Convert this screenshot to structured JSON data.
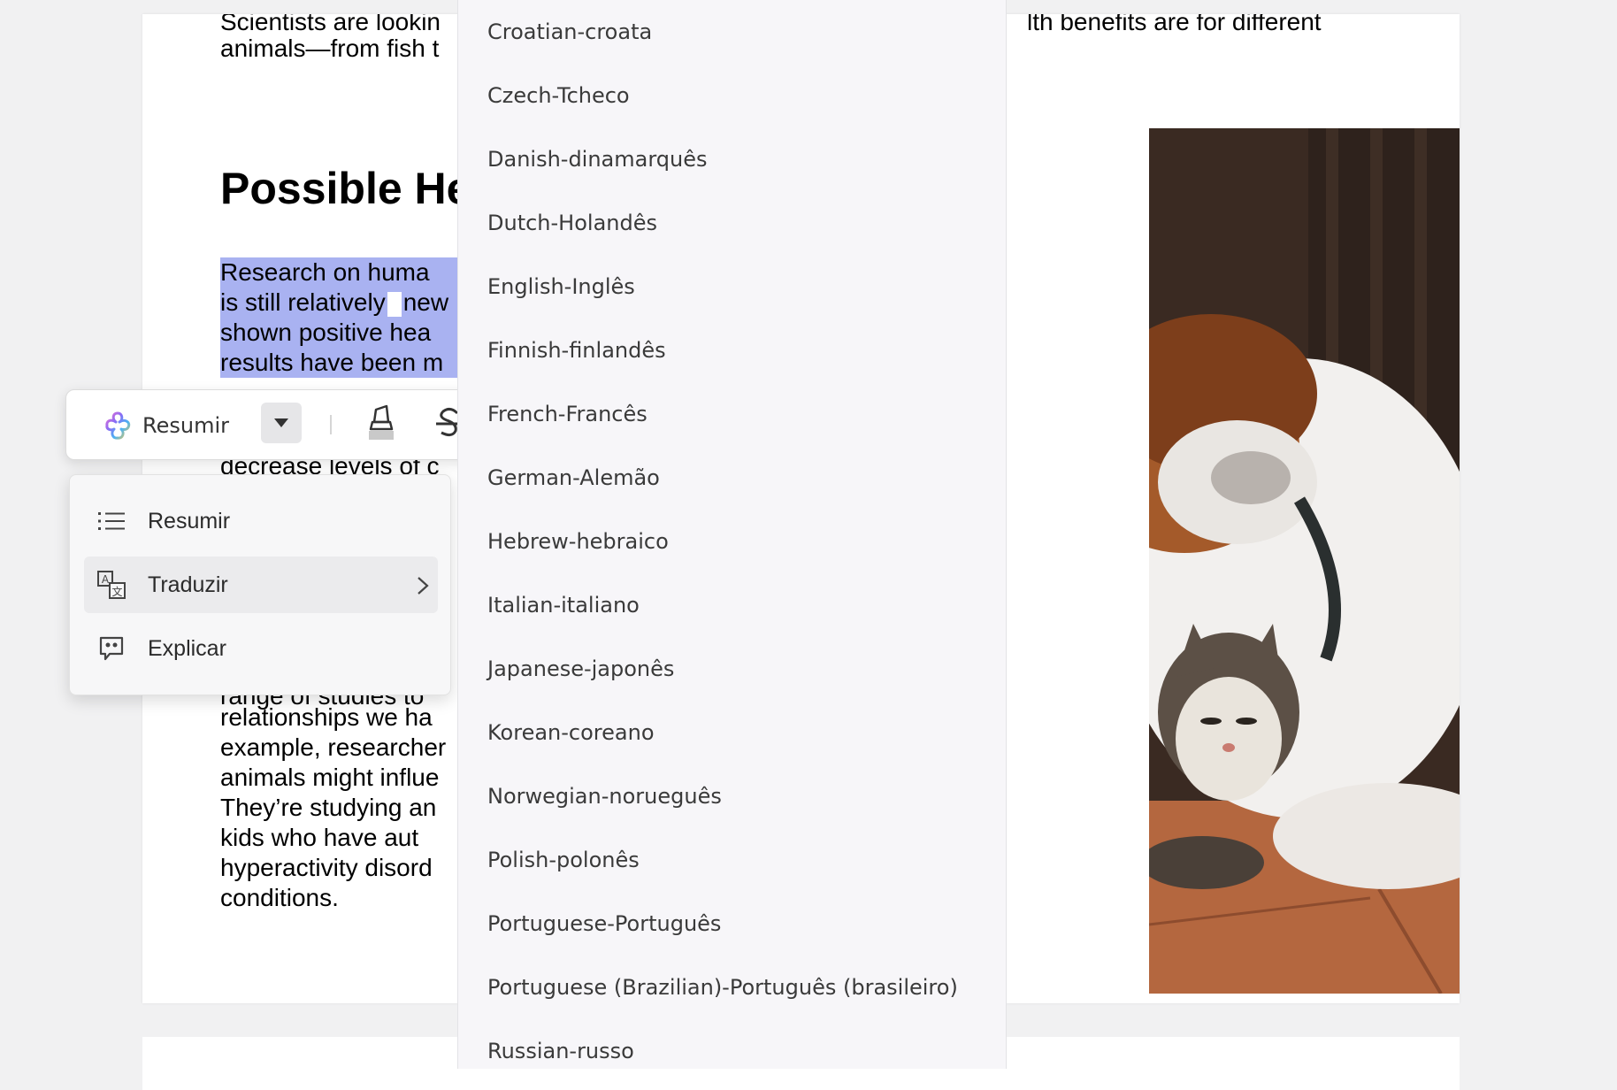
{
  "document": {
    "top_line1": "Scientists are lookin",
    "top_line1_right": "lth benefits are for different",
    "top_line2": "animals—from fish t",
    "heading": "Possible He",
    "selected_lines": [
      "Research on huma",
      "is still relatively",
      "new",
      "shown positive hea",
      "results have been m"
    ],
    "behind_toolbar": "decrease levels of c",
    "lower_lines": [
      "range of studies to",
      "relationships we ha",
      "example, researcher",
      "animals might influe",
      "They’re studying an",
      "kids who have aut",
      "hyperactivity disord",
      "conditions."
    ]
  },
  "toolbar": {
    "ai_label": "Resumir",
    "dropdown_icon": "caret-down-icon",
    "highlight_icon": "highlighter-icon",
    "strike_icon": "strikethrough-icon"
  },
  "ai_menu": {
    "items": [
      {
        "label": "Resumir",
        "icon": "list-icon"
      },
      {
        "label": "Traduzir",
        "icon": "translate-icon",
        "has_submenu": true
      },
      {
        "label": "Explicar",
        "icon": "quote-bubble-icon"
      }
    ]
  },
  "languages": [
    "Croatian-croata",
    "Czech-Tcheco",
    "Danish-dinamarquês",
    "Dutch-Holandês",
    "English-Inglês",
    "Finnish-finlandês",
    "French-Francês",
    "German-Alemão",
    "Hebrew-hebraico",
    "Italian-italiano",
    "Japanese-japonês",
    "Korean-coreano",
    "Norwegian-norueguês",
    "Polish-polonês",
    "Portuguese-Português",
    "Portuguese (Brazilian)-Português (brasileiro)",
    "Russian-russo"
  ]
}
